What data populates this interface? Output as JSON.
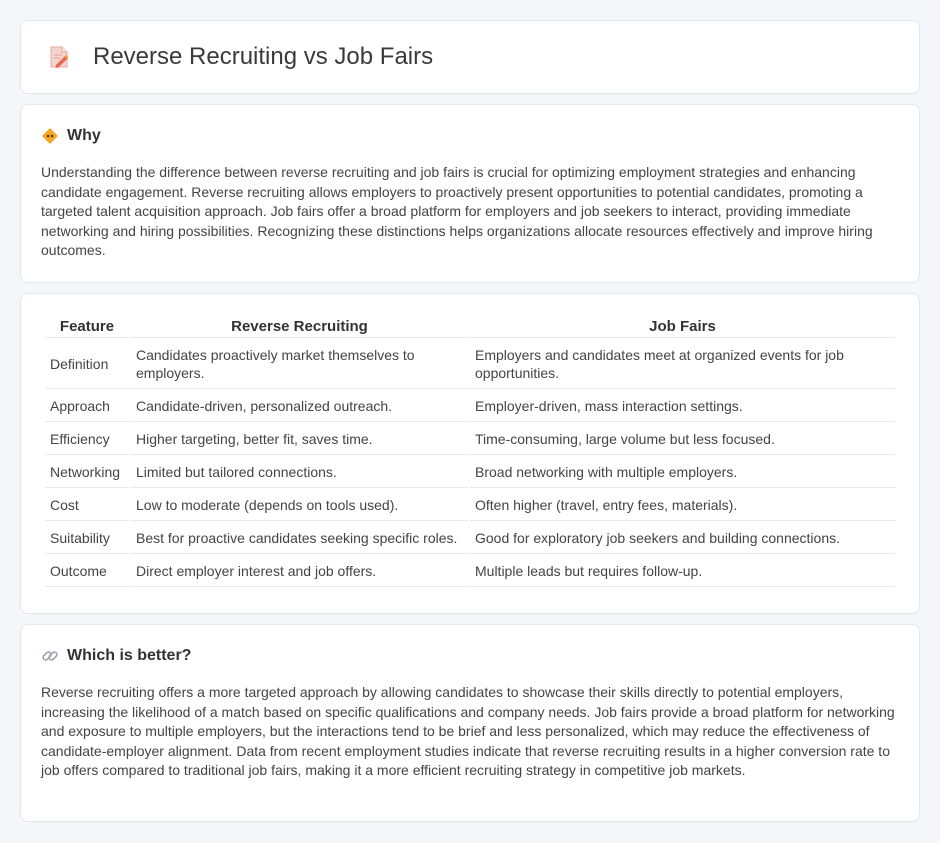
{
  "header": {
    "title": "Reverse Recruiting vs Job Fairs",
    "icon": "document-pencil-icon"
  },
  "why": {
    "title": "Why",
    "icon": "diamond-icon",
    "text": "Understanding the difference between reverse recruiting and job fairs is crucial for optimizing employment strategies and enhancing candidate engagement. Reverse recruiting allows employers to proactively present opportunities to potential candidates, promoting a targeted talent acquisition approach. Job fairs offer a broad platform for employers and job seekers to interact, providing immediate networking and hiring possibilities. Recognizing these distinctions helps organizations allocate resources effectively and improve hiring outcomes."
  },
  "table": {
    "headers": [
      "Feature",
      "Reverse Recruiting",
      "Job Fairs"
    ],
    "rows": [
      [
        "Definition",
        "Candidates proactively market themselves to employers.",
        "Employers and candidates meet at organized events for job opportunities."
      ],
      [
        "Approach",
        "Candidate-driven, personalized outreach.",
        "Employer-driven, mass interaction settings."
      ],
      [
        "Efficiency",
        "Higher targeting, better fit, saves time.",
        "Time-consuming, large volume but less focused."
      ],
      [
        "Networking",
        "Limited but tailored connections.",
        "Broad networking with multiple employers."
      ],
      [
        "Cost",
        "Low to moderate (depends on tools used).",
        "Often higher (travel, entry fees, materials)."
      ],
      [
        "Suitability",
        "Best for proactive candidates seeking specific roles.",
        "Good for exploratory job seekers and building connections."
      ],
      [
        "Outcome",
        "Direct employer interest and job offers.",
        "Multiple leads but requires follow-up."
      ]
    ]
  },
  "better": {
    "title": "Which is better?",
    "icon": "link-icon",
    "text": "Reverse recruiting offers a more targeted approach by allowing candidates to showcase their skills directly to potential employers, increasing the likelihood of a match based on specific qualifications and company needs. Job fairs provide a broad platform for networking and exposure to multiple employers, but the interactions tend to be brief and less personalized, which may reduce the effectiveness of candidate-employer alignment. Data from recent employment studies indicate that reverse recruiting results in a higher conversion rate to job offers compared to traditional job fairs, making it a more efficient recruiting strategy in competitive job markets."
  }
}
